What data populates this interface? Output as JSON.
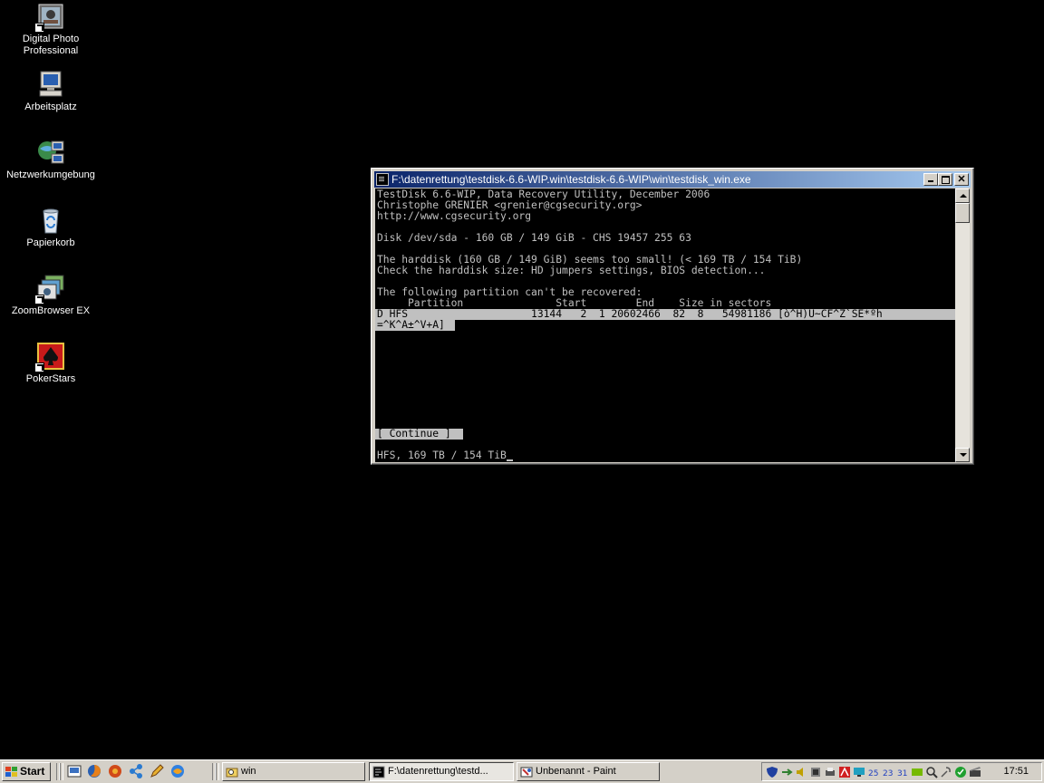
{
  "desktop": {
    "icons": [
      {
        "label": "Digital Photo Professional"
      },
      {
        "label": "Arbeitsplatz"
      },
      {
        "label": "Netzwerkumgebung"
      },
      {
        "label": "Papierkorb"
      },
      {
        "label": "ZoomBrowser EX"
      },
      {
        "label": "PokerStars"
      }
    ]
  },
  "window": {
    "title": "F:\\datenrettung\\testdisk-6.6-WIP.win\\testdisk-6.6-WIP\\win\\testdisk_win.exe",
    "console": {
      "line1": "TestDisk 6.6-WIP, Data Recovery Utility, December 2006",
      "line2": "Christophe GRENIER <grenier@cgsecurity.org>",
      "line3": "http://www.cgsecurity.org",
      "line4": "Disk /dev/sda - 160 GB / 149 GiB - CHS 19457 255 63",
      "line5": "The harddisk (160 GB / 149 GiB) seems too small! (< 169 TB / 154 TiB)",
      "line6": "Check the harddisk size: HD jumpers settings, BIOS detection...",
      "line7": "The following partition can't be recovered:",
      "header": "     Partition               Start        End    Size in sectors",
      "partition_row": "D HFS                    13144   2  1 20602466  82  8   54981186 [ò^H)U~CF^Z`SE*ºh",
      "partition_row_cont": "=^K^A±^V+A]",
      "continue_button": "[ Continue ]",
      "status": "HFS, 169 TB / 154 TiB"
    }
  },
  "taskbar": {
    "start_label": "Start",
    "tasks": [
      {
        "label": "win"
      },
      {
        "label": "F:\\datenrettung\\testd..."
      },
      {
        "label": "Unbenannt - Paint"
      }
    ],
    "clock": "17:51"
  }
}
